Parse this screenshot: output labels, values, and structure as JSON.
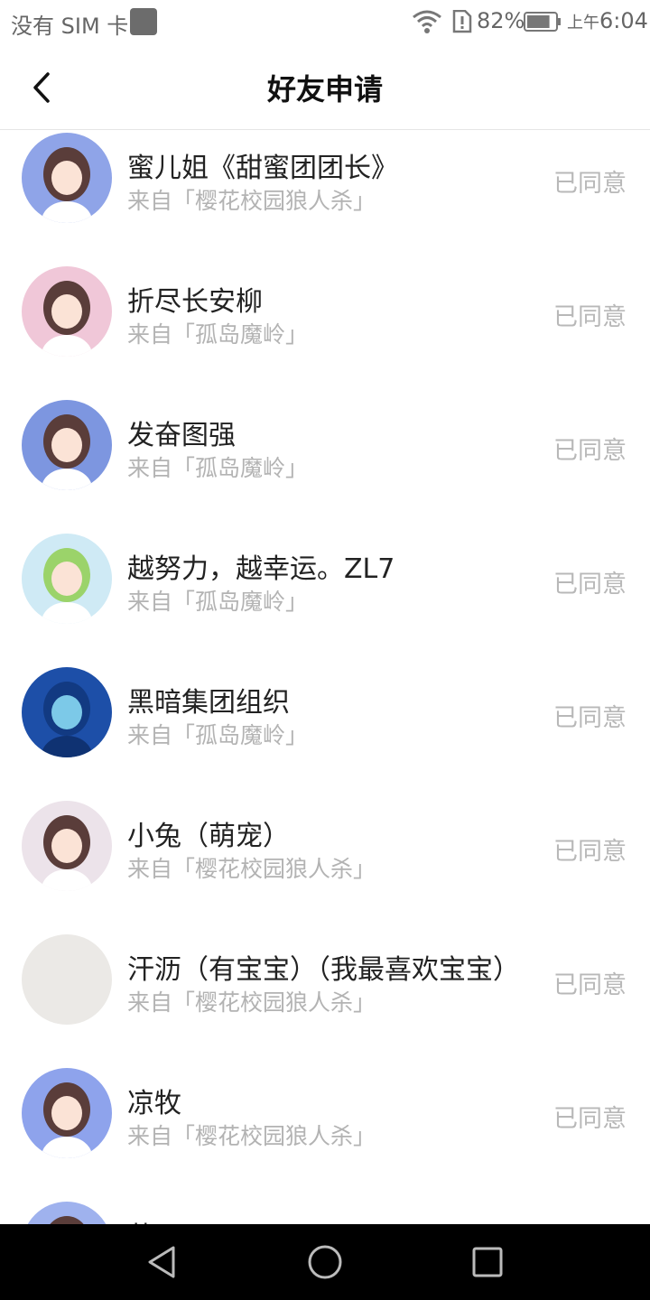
{
  "status_bar": {
    "carrier": "没有 SIM 卡",
    "battery_percent": "82%",
    "time_prefix": "上午",
    "time": "6:04",
    "battery_level": 0.82,
    "icons": [
      "sim-icon",
      "wifi-icon",
      "alert-icon",
      "battery-icon"
    ]
  },
  "header": {
    "title": "好友申请",
    "back_icon": "chevron-left-icon"
  },
  "requests": [
    {
      "name": "蜜儿姐《甜蜜团团长》",
      "source": "来自「樱花校园狼人杀」",
      "status": "已同意",
      "avatar_color": "#8fa4e8"
    },
    {
      "name": "折尽长安柳",
      "source": "来自「孤岛魔岭」",
      "status": "已同意",
      "avatar_color": "#f0c7d8"
    },
    {
      "name": "发奋图强",
      "source": "来自「孤岛魔岭」",
      "status": "已同意",
      "avatar_color": "#7d96e0"
    },
    {
      "name": "越努力，越幸运。ZL7",
      "source": "来自「孤岛魔岭」",
      "status": "已同意",
      "avatar_color": "#cfeaf5"
    },
    {
      "name": "黑暗集团组织",
      "source": "来自「孤岛魔岭」",
      "status": "已同意",
      "avatar_color": "#1d4fa8"
    },
    {
      "name": "小兔（萌宠）",
      "source": "来自「樱花校园狼人杀」",
      "status": "已同意",
      "avatar_color": "#ece3ea"
    },
    {
      "name": "汗沥（有宝宝）（我最喜欢宝宝）",
      "source": "来自「樱花校园狼人杀」",
      "status": "已同意",
      "avatar_color": "#ebe9e6"
    },
    {
      "name": "凉牧",
      "source": "来自「樱花校园狼人杀」",
      "status": "已同意",
      "avatar_color": "#8ea3ec"
    },
    {
      "name": "莫凡",
      "source": "",
      "status": "",
      "avatar_color": "#9fb2ee"
    }
  ],
  "nav_bar": {
    "buttons": [
      "back-triangle-icon",
      "home-circle-icon",
      "recents-square-icon"
    ]
  }
}
